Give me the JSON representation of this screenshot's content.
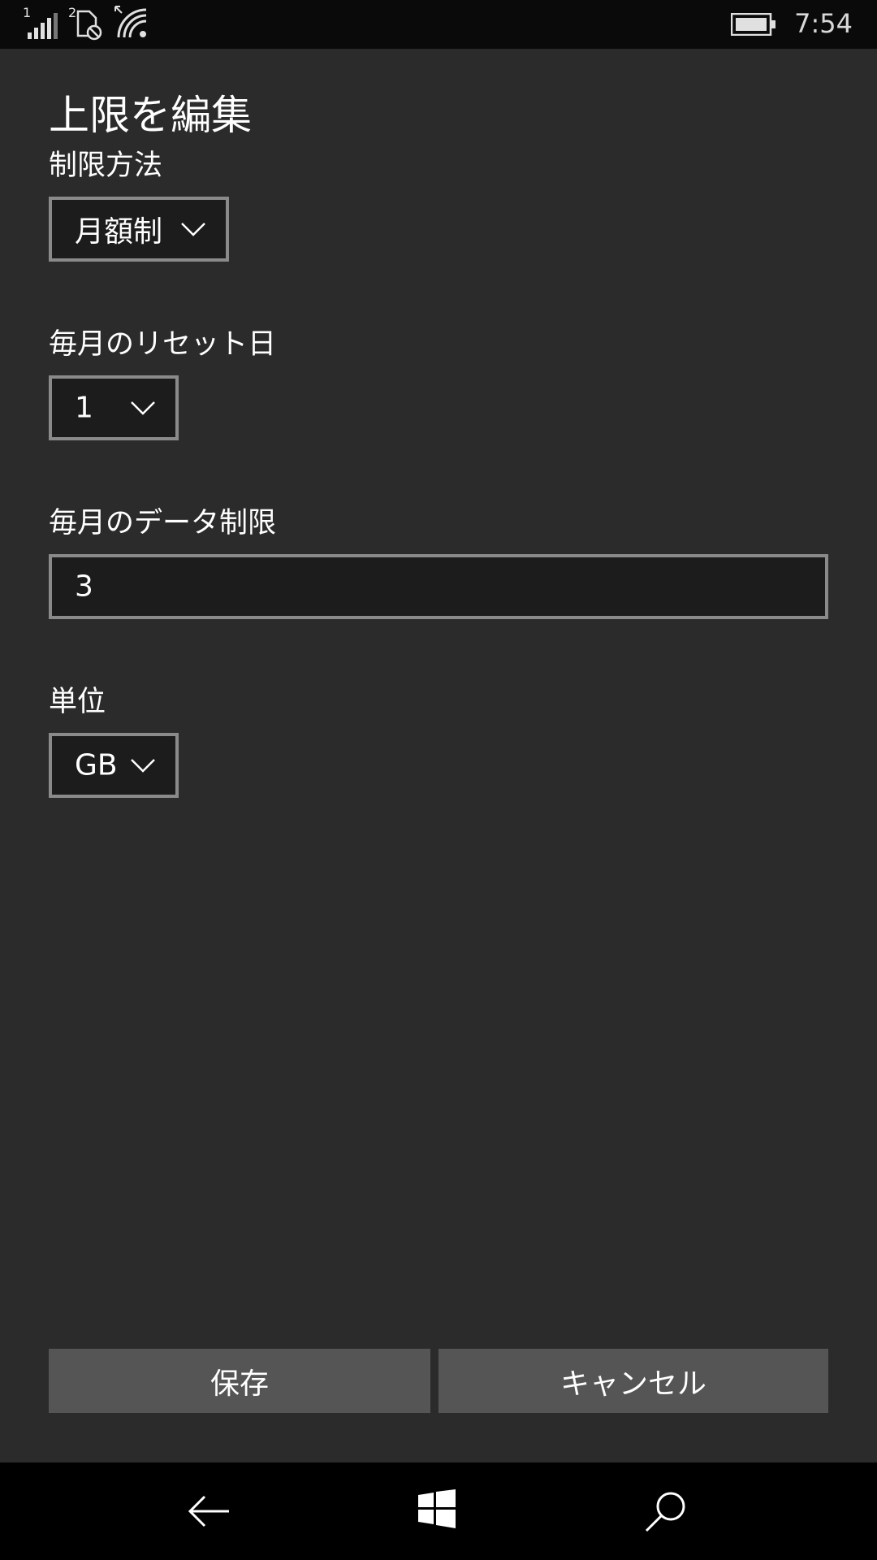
{
  "status_bar": {
    "sim1_label": "1",
    "sim2_label": "2",
    "time": "7:54",
    "icons": [
      "signal-bars-icon",
      "sim-data-restricted-icon",
      "wifi-icon",
      "battery-icon"
    ]
  },
  "page": {
    "title": "上限を編集"
  },
  "form": {
    "limit_type": {
      "label": "制限方法",
      "selected": "月額制"
    },
    "reset_day": {
      "label": "毎月のリセット日",
      "selected": "1"
    },
    "data_limit": {
      "label": "毎月のデータ制限",
      "value": "3"
    },
    "unit": {
      "label": "単位",
      "selected": "GB"
    }
  },
  "buttons": {
    "save_label": "保存",
    "cancel_label": "キャンセル"
  },
  "nav_bar": {
    "icons": [
      "back-arrow-icon",
      "windows-logo-icon",
      "search-icon"
    ]
  },
  "colors": {
    "background": "#2b2b2b",
    "status_bar": "#0a0a0a",
    "nav_bar": "#000000",
    "input_background": "#1c1c1c",
    "input_border": "#8a8a8a",
    "button_background": "#555555"
  }
}
